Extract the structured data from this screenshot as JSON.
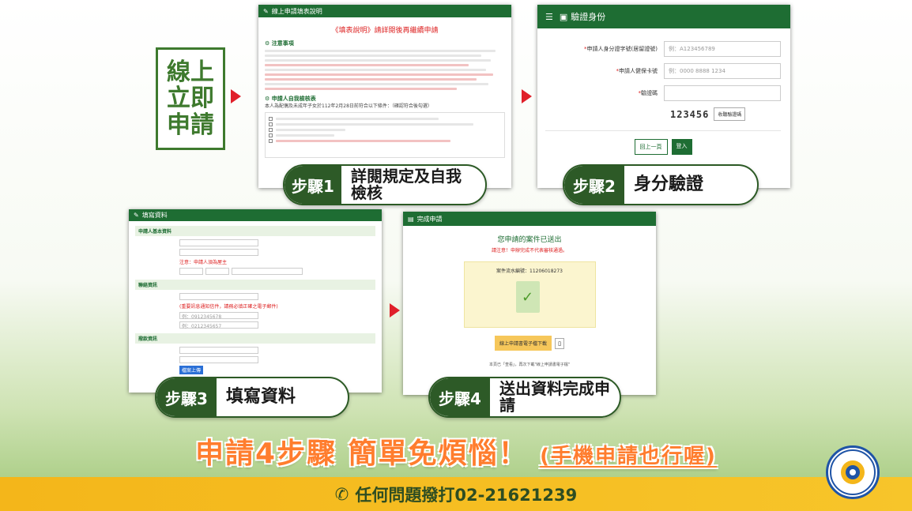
{
  "title": {
    "line1": "線上",
    "line2": "立即",
    "line3": "申請"
  },
  "panel1": {
    "header": "線上申請填表說明",
    "heading": "《填表說明》請詳閱後再繼續申請",
    "section1": "注意事項",
    "section2": "申請人自我檢核表",
    "check_intro": "本人為配偶及未成年子女於112年2月28日前符合以下條件：（確認符合後勾選）"
  },
  "panel2": {
    "header": "驗證身份",
    "label_id": "申請人身分證字號(居留證號)",
    "placeholder_id": "例：A123456789",
    "label_card": "申請人健保卡號",
    "placeholder_card": "例：0000 8888 1234",
    "label_captcha": "驗證碼",
    "captcha_value": "123456",
    "captcha_refresh": "收聽驗證碼",
    "btn_back": "回上一頁",
    "btn_login": "登入"
  },
  "panel3": {
    "header": "填寫資料",
    "sec1": "申請人基本資料",
    "sec2": "聯絡資訊",
    "sec3": "撥款資訊",
    "name_hint": "注意：申請人須為屋主",
    "email_hint": "(重要訊息通知信件，請務必填正確之電子郵件)",
    "phone_ph": "例：0912345678",
    "tel_ph": "例：0212345657",
    "btn_upload": "檔案上傳"
  },
  "panel4": {
    "header": "完成申請",
    "done": "您申請的案件已送出",
    "notice": "請注意！申辦完成不代表審核通過。",
    "case_no": "案件流水編號：11206018273",
    "download": "線上申請書電子檔下載",
    "footer_note": "本頁已「查看」，再次下載\"線上申請書電子檔\""
  },
  "steps": [
    {
      "num": "步驟1",
      "text": "詳閱規定及自我檢核"
    },
    {
      "num": "步驟2",
      "text": "身分驗證"
    },
    {
      "num": "步驟3",
      "text": "填寫資料"
    },
    {
      "num": "步驟4",
      "text": "送出資料完成申請"
    }
  ],
  "slogan": {
    "main": "申請4步驟 簡單免煩惱！",
    "sub": "(手機申請也行喔)"
  },
  "footer": {
    "phone": "任何問題撥打02-21621239"
  },
  "seal": {
    "text": "MINISTRY OF THE INTERIOR",
    "name": "內政部"
  },
  "colors": {
    "green": "#2d5a27",
    "accent": "#e0202a",
    "orange": "#ff7d2e",
    "yellow": "#f4b61a"
  }
}
